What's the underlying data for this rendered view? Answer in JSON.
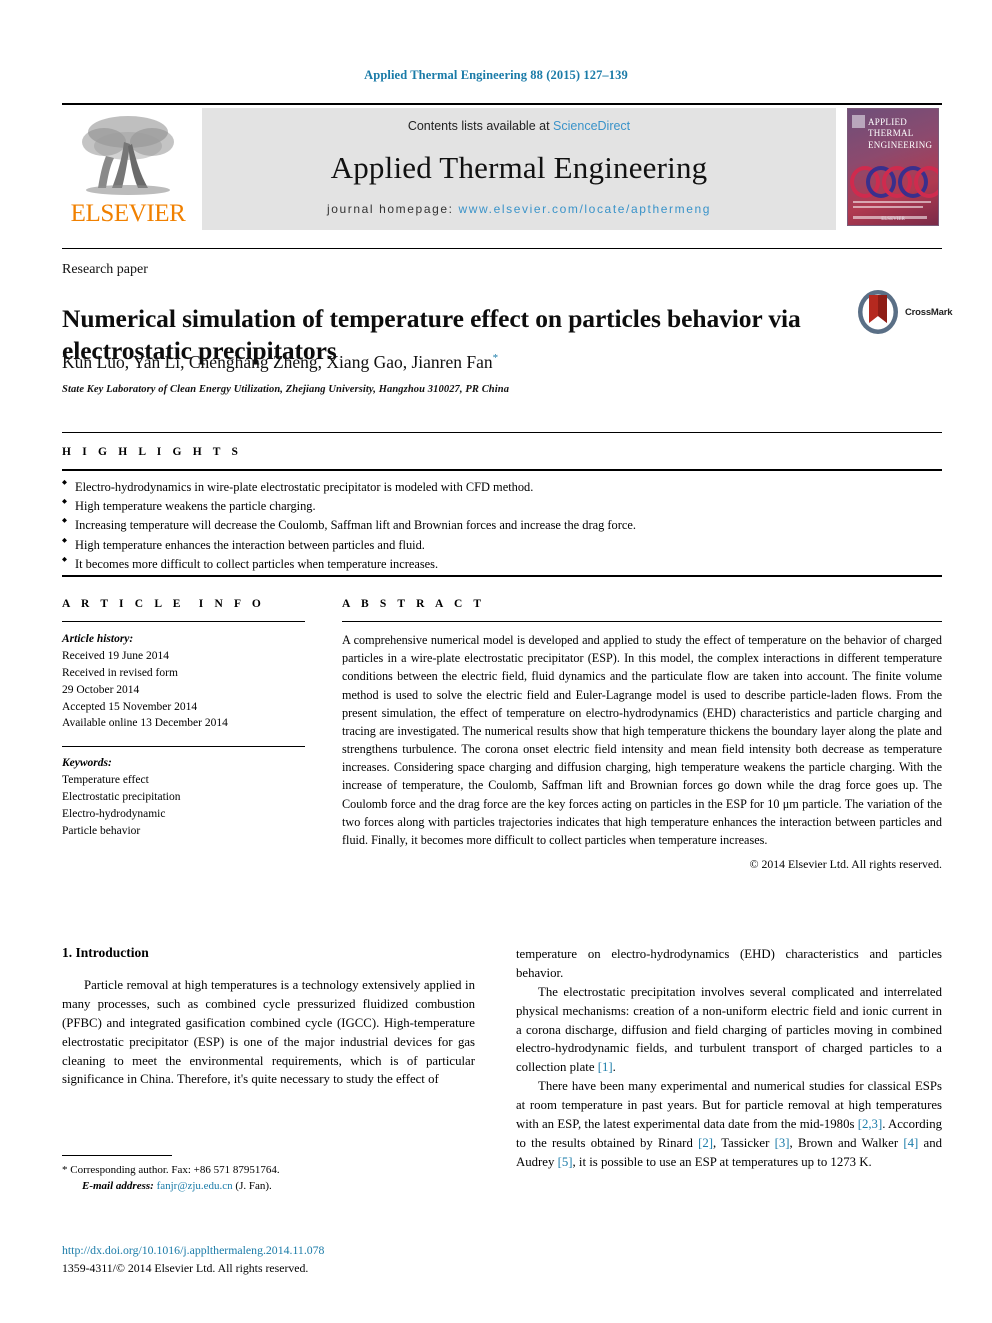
{
  "running_head": "Applied Thermal Engineering 88 (2015) 127–139",
  "masthead": {
    "publisher_logo_label": "ELSEVIER",
    "contents_prefix": "Contents lists available at",
    "contents_link": "ScienceDirect",
    "journal_name": "Applied Thermal Engineering",
    "homepage_prefix": "journal homepage:",
    "homepage_url": "www.elsevier.com/locate/apthermeng",
    "cover": {
      "line1": "APPLIED",
      "line2": "THERMAL",
      "line3": "ENGINEERING",
      "footer": "ELSEVIER"
    },
    "link_color": "#3a93c9",
    "band_color": "#e3e3e3"
  },
  "article": {
    "doctype": "Research paper",
    "title": "Numerical simulation of temperature effect on particles behavior via electrostatic precipitators",
    "authors": "Kun Luo, Yan Li, Chenghang Zheng, Xiang Gao, Jianren Fan",
    "author_marker": "*",
    "affiliation": "State Key Laboratory of Clean Energy Utilization, Zhejiang University, Hangzhou 310027, PR China",
    "crossmark_label": "CrossMark"
  },
  "highlights": {
    "heading": "HIGHLIGHTS",
    "items": [
      "Electro-hydrodynamics in wire-plate electrostatic precipitator is modeled with CFD method.",
      "High temperature weakens the particle charging.",
      "Increasing temperature will decrease the Coulomb, Saffman lift and Brownian forces and increase the drag force.",
      "High temperature enhances the interaction between particles and fluid.",
      "It becomes more difficult to collect particles when temperature increases."
    ]
  },
  "article_info": {
    "heading": "ARTICLE INFO",
    "history_label": "Article history:",
    "history": [
      "Received 19 June 2014",
      "Received in revised form",
      "29 October 2014",
      "Accepted 15 November 2014",
      "Available online 13 December 2014"
    ],
    "keywords_label": "Keywords:",
    "keywords": [
      "Temperature effect",
      "Electrostatic precipitation",
      "Electro-hydrodynamic",
      "Particle behavior"
    ]
  },
  "abstract": {
    "heading": "ABSTRACT",
    "body": "A comprehensive numerical model is developed and applied to study the effect of temperature on the behavior of charged particles in a wire-plate electrostatic precipitator (ESP). In this model, the complex interactions in different temperature conditions between the electric field, fluid dynamics and the particulate flow are taken into account. The finite volume method is used to solve the electric field and Euler-Lagrange model is used to describe particle-laden flows. From the present simulation, the effect of temperature on electro-hydrodynamics (EHD) characteristics and particle charging and tracing are investigated. The numerical results show that high temperature thickens the boundary layer along the plate and strengthens turbulence. The corona onset electric field intensity and mean field intensity both decrease as temperature increases. Considering space charging and diffusion charging, high temperature weakens the particle charging. With the increase of temperature, the Coulomb, Saffman lift and Brownian forces go down while the drag force goes up. The Coulomb force and the drag force are the key forces acting on particles in the ESP for 10 μm particle. The variation of the two forces along with particles trajectories indicates that high temperature enhances the interaction between particles and fluid. Finally, it becomes more difficult to collect particles when temperature increases.",
    "copyright": "© 2014 Elsevier Ltd. All rights reserved."
  },
  "body": {
    "section_title": "1. Introduction",
    "left_paragraph_1": "Particle removal at high temperatures is a technology extensively applied in many processes, such as combined cycle pressurized fluidized combustion (PFBC) and integrated gasification combined cycle (IGCC). High-temperature electrostatic precipitator (ESP) is one of the major industrial devices for gas cleaning to meet the environmental requirements, which is of particular significance in China. Therefore, it's quite necessary to study the effect of",
    "right_paragraph_1": "temperature on electro-hydrodynamics (EHD) characteristics and particles behavior.",
    "right_paragraph_2_a": "The electrostatic precipitation involves several complicated and interrelated physical mechanisms: creation of a non-uniform electric field and ionic current in a corona discharge, diffusion and field charging of particles moving in combined electro-hydrodynamic fields, and turbulent transport of charged particles to a collection plate ",
    "right_paragraph_2_ref": "[1]",
    "right_paragraph_2_b": ".",
    "right_paragraph_3_a": "There have been many experimental and numerical studies for classical ESPs at room temperature in past years. But for particle removal at high temperatures with an ESP, the latest experimental data date from the mid-1980s ",
    "right_paragraph_3_ref1": "[2,3]",
    "right_paragraph_3_b": ". According to the results obtained by Rinard ",
    "right_paragraph_3_ref2": "[2]",
    "right_paragraph_3_c": ", Tassicker ",
    "right_paragraph_3_ref3": "[3]",
    "right_paragraph_3_d": ", Brown and Walker ",
    "right_paragraph_3_ref4": "[4]",
    "right_paragraph_3_e": " and Audrey ",
    "right_paragraph_3_ref5": "[5]",
    "right_paragraph_3_f": ", it is possible to use an ESP at temperatures up to 1273 K."
  },
  "footer": {
    "corresponding_marker": "*",
    "corresponding_text": "Corresponding author. Fax: +86 571 87951764.",
    "email_label": "E-mail address:",
    "email": "fanjr@zju.edu.cn",
    "email_suffix": "(J. Fan).",
    "doi": "http://dx.doi.org/10.1016/j.applthermaleng.2014.11.078",
    "issn_line": "1359-4311/© 2014 Elsevier Ltd. All rights reserved."
  }
}
